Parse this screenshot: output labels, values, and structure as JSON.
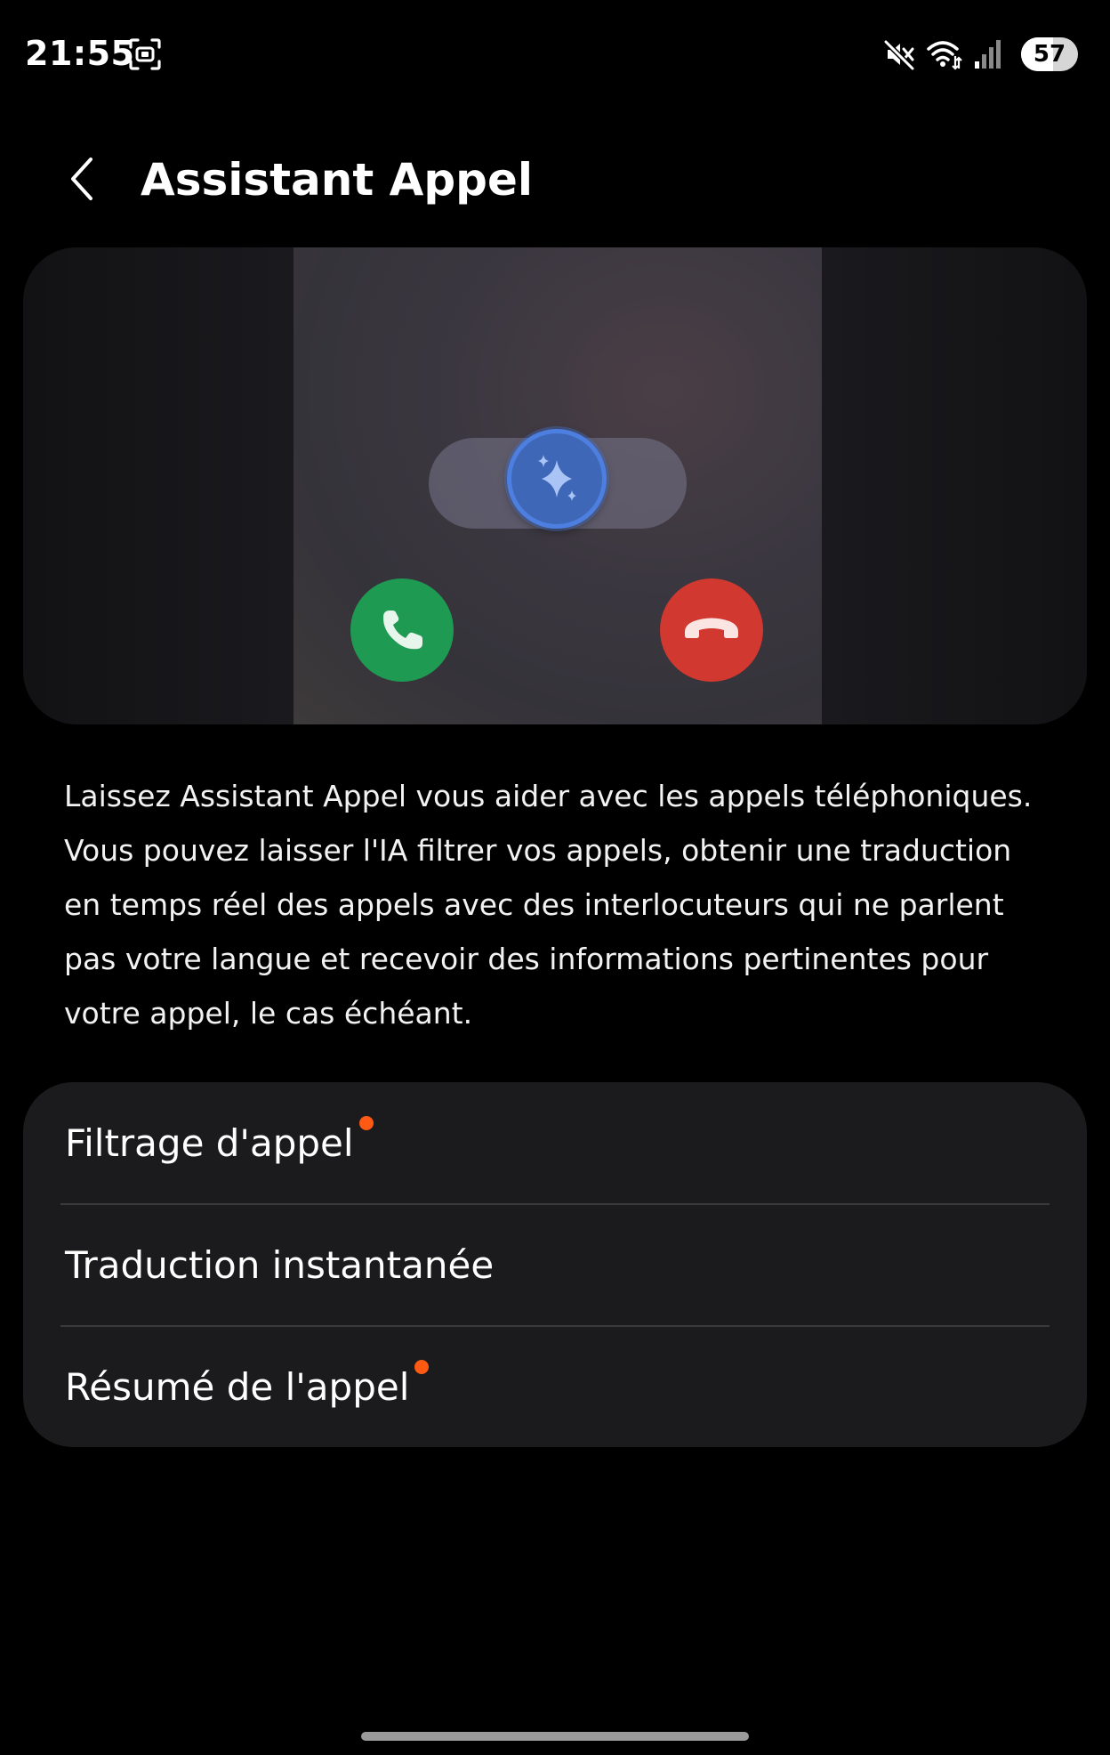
{
  "status_bar": {
    "time": "21:55",
    "battery_level": "57",
    "battery_fraction": 0.57,
    "icons": [
      "screenshot-icon",
      "mute-icon",
      "wifi-icon",
      "signal-icon",
      "battery-icon"
    ]
  },
  "header": {
    "title": "Assistant Appel",
    "back_icon": "chevron-left-icon"
  },
  "illustration": {
    "icons": [
      "ai-sparkle-icon",
      "phone-accept-icon",
      "phone-decline-icon"
    ],
    "colors": {
      "accept": "#1f9a52",
      "decline": "#d1382f",
      "ai": "#3f67b8"
    }
  },
  "description": "Laissez Assistant Appel vous aider avec les appels téléphoniques. Vous pouvez laisser l'IA filtrer vos appels, obtenir une traduction en temps réel des appels avec des interlocuteurs qui ne parlent pas votre langue et recevoir des informations pertinentes pour votre appel, le cas échéant.",
  "settings": {
    "items": [
      {
        "label": "Filtrage d'appel",
        "new_badge": true
      },
      {
        "label": "Traduction instantanée",
        "new_badge": false
      },
      {
        "label": "Résumé de l'appel",
        "new_badge": true
      }
    ],
    "badge_color": "#ff5a14"
  }
}
